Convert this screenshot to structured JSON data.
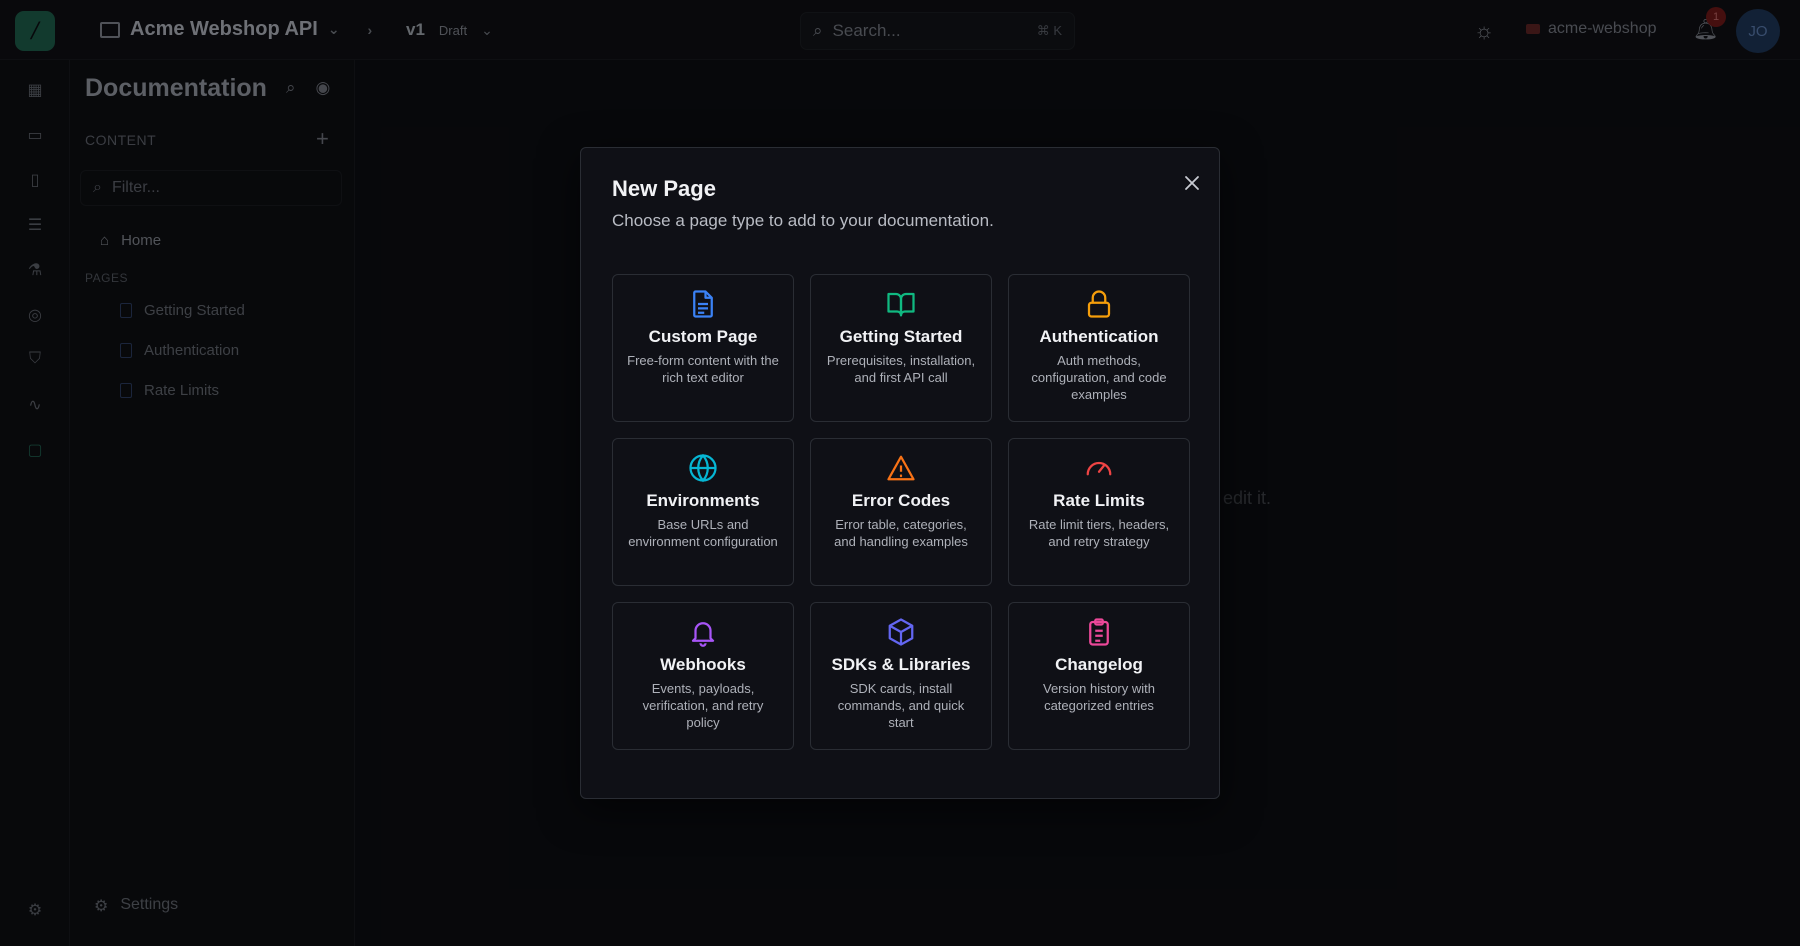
{
  "topbar": {
    "project_name": "Acme Webshop API",
    "version": "v1",
    "version_status": "Draft",
    "search_placeholder": "Search...",
    "search_shortcut": "⌘ K",
    "org_name": "acme-webshop",
    "notification_count": "1",
    "avatar_initials": "JO"
  },
  "sidebar": {
    "title": "Documentation",
    "content_label": "CONTENT",
    "filter_placeholder": "Filter...",
    "home_label": "Home",
    "pages_label": "PAGES",
    "pages": [
      "Getting Started",
      "Authentication",
      "Rate Limits"
    ],
    "settings_label": "Settings"
  },
  "background_hint": "r edit it.",
  "modal": {
    "title": "New Page",
    "subtitle": "Choose a page type to add to your documentation.",
    "cards": [
      {
        "title": "Custom Page",
        "desc": "Free-form content with the rich text editor",
        "icon": "document-icon",
        "color": "#3b82f6"
      },
      {
        "title": "Getting Started",
        "desc": "Prerequisites, installation, and first API call",
        "icon": "book-open-icon",
        "color": "#10b981"
      },
      {
        "title": "Authentication",
        "desc": "Auth methods, configuration, and code examples",
        "icon": "lock-icon",
        "color": "#f59e0b"
      },
      {
        "title": "Environments",
        "desc": "Base URLs and environment configuration",
        "icon": "globe-icon",
        "color": "#06b6d4"
      },
      {
        "title": "Error Codes",
        "desc": "Error table, categories, and handling examples",
        "icon": "warning-triangle-icon",
        "color": "#f97316"
      },
      {
        "title": "Rate Limits",
        "desc": "Rate limit tiers, headers, and retry strategy",
        "icon": "gauge-icon",
        "color": "#ef4444"
      },
      {
        "title": "Webhooks",
        "desc": "Events, payloads, verification, and retry policy",
        "icon": "bell-icon",
        "color": "#a855f7"
      },
      {
        "title": "SDKs & Libraries",
        "desc": "SDK cards, install commands, and quick start",
        "icon": "package-icon",
        "color": "#6366f1"
      },
      {
        "title": "Changelog",
        "desc": "Version history with categorized entries",
        "icon": "clipboard-list-icon",
        "color": "#ec4899"
      }
    ]
  }
}
